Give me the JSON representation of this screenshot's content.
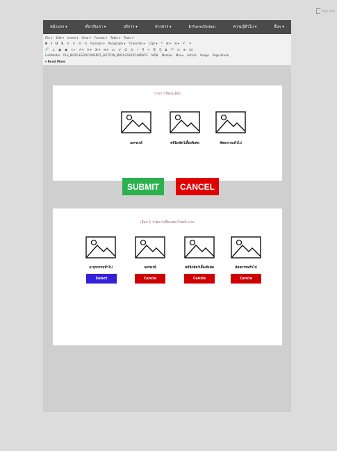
{
  "sign_out": "Sign Out",
  "nav": [
    "หน้าแรก ▾",
    "เกี่ยวกับเรา ▾",
    "บริการ ▾",
    "ข่าวสาร ▾",
    "E-Form/Onlion",
    "ความรู้ทั่วไป ▾",
    "อื่นๆ ▾"
  ],
  "toolbar": {
    "menu_row": [
      "File ▾",
      "Edit ▾",
      "Insert ▾",
      "View ▾",
      "Format ▾",
      "Table ▾",
      "Tools ▾"
    ],
    "format_row_1": [
      "B",
      "I",
      "U",
      "S",
      "≡",
      "≡",
      "≡",
      "≡",
      "Formats ▾",
      "Paragraph ▾",
      "Times Ne ▾",
      "12pt ▾",
      "❝",
      "☰ ▾",
      "☰ ▾",
      "↶",
      "↷"
    ],
    "format_row_2": [
      "🔗",
      "⚓",
      "▣",
      "▣",
      "<>",
      "A ▾",
      "A ▾",
      "⌘ ▾",
      "⊞ ▾",
      "x₂",
      "x²",
      "Ω",
      "☺",
      "─",
      "¶",
      "✂",
      "⎘",
      "⎗",
      "⧉",
      "❝❞",
      "⊡",
      "⊕",
      "(x)"
    ],
    "plugin_row": [
      "LinkModel",
      "PLS_MDFILESDOCUMENTS_BUTTON_MDFILESDOCUMENTS",
      "MDB",
      "Module",
      "Menu",
      "Article",
      "Image",
      "Page Break"
    ],
    "read_more": "Read More"
  },
  "card1": {
    "title": "รายการที่คุณเลือก",
    "items": [
      "เอกชเรย์",
      "คลินิกสัตว์เลี้ยงพิเศษ",
      "ศัลยกรรมทั่วไป"
    ]
  },
  "actions": {
    "submit": "SUBMIT",
    "cancel": "CANCEL"
  },
  "card2": {
    "title": "เลือก 1 รายการเพื่อแสดงในหน้าแรก",
    "items": [
      {
        "label": "อายุรกรรมทั่วไป",
        "button": "Select",
        "variant": "blue"
      },
      {
        "label": "เอกชเรย์",
        "button": "Cancle",
        "variant": "red"
      },
      {
        "label": "คลินิกสัตว์เลี้ยงพิเศษ",
        "button": "Cancle",
        "variant": "red"
      },
      {
        "label": "ศัลยกรรมทั่วไป",
        "button": "Cancle",
        "variant": "red"
      }
    ]
  },
  "colors": {
    "nav_bg": "#4a4a4a",
    "submit": "#2bb24c",
    "cancel": "#e00000",
    "select": "#3320d8",
    "cancle": "#d00000"
  }
}
